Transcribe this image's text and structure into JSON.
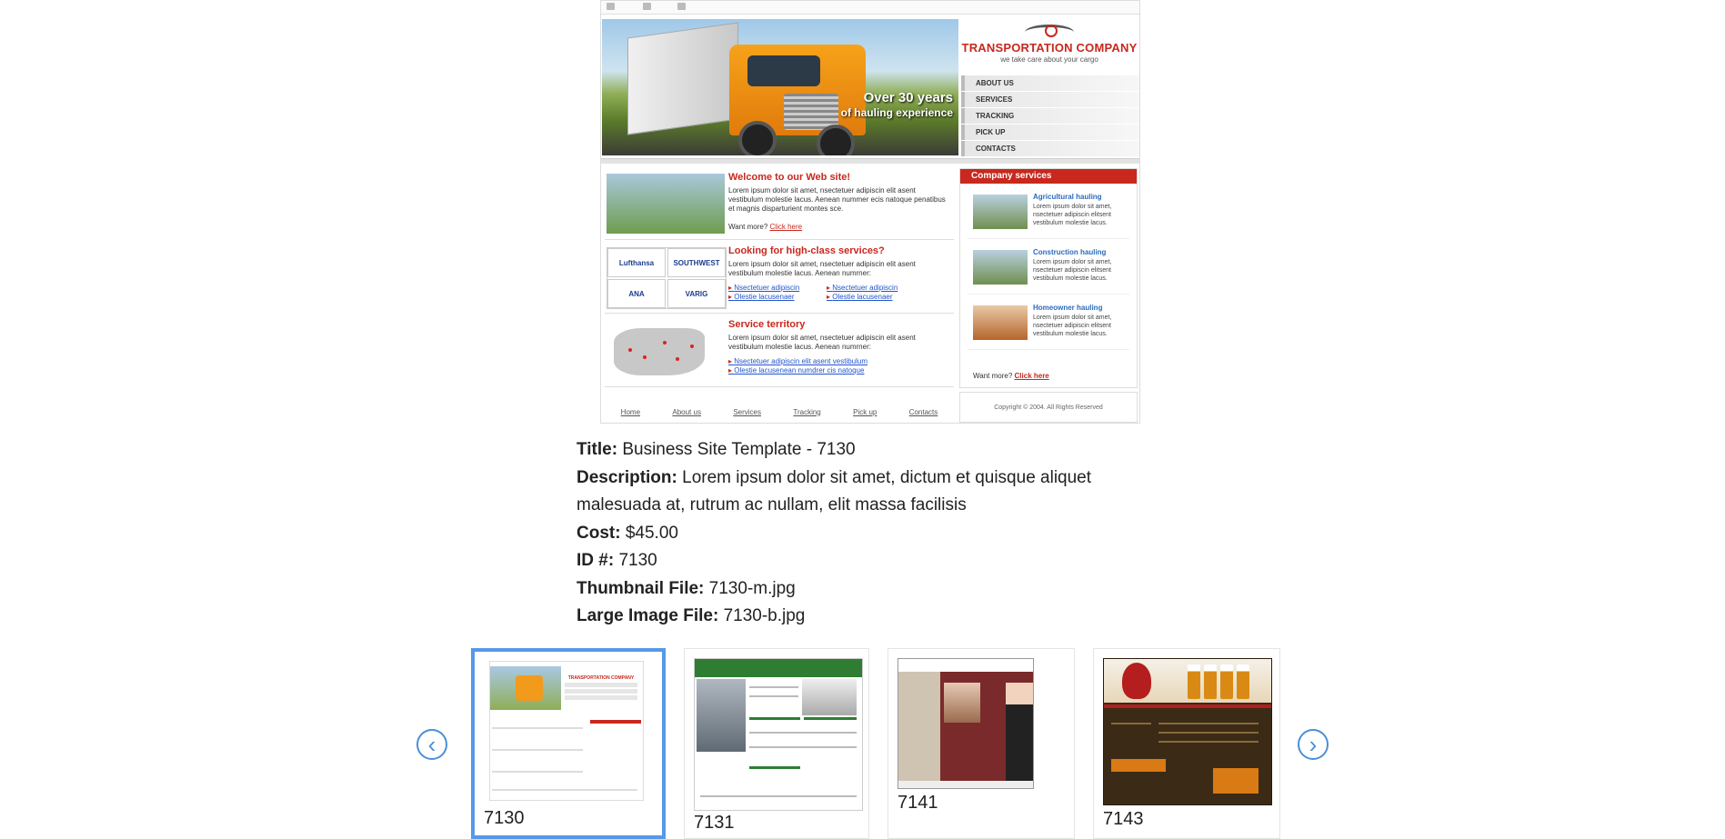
{
  "preview": {
    "hero_line1": "Over 30 years",
    "hero_line2": "of hauling experience",
    "logo": "TRANSPORTATION COMPANY",
    "tagline": "we take care about your cargo",
    "menu": [
      "ABOUT US",
      "SERVICES",
      "TRACKING",
      "PICK UP",
      "CONTACTS"
    ],
    "welcome_title": "Welcome to our Web site!",
    "welcome_text": "Lorem ipsum dolor sit amet, nsectetuer adipiscin elit asent vestibulum molestie lacus. Aenean nummer ecis natoque penatibus et magnis disparturient montes sce.",
    "want_more": "Want more?",
    "click_here": "Click here",
    "services_title": "Looking for high-class services?",
    "services_text": "Lorem ipsum dolor sit amet, nsectetuer adipiscin elit asent vestibulum molestie lacus. Aenean numrner:",
    "services_links": [
      "Nsectetuer adipiscin",
      "Olestie lacusenaer",
      "Nsectetuer adipiscin",
      "Olestie lacusenaer"
    ],
    "logos": [
      "Lufthansa",
      "SOUTHWEST",
      "ANA",
      "VARIG"
    ],
    "territory_title": "Service territory",
    "territory_text": "Lorem ipsum dolor sit amet, nsectetuer adipiscin elit asent vestibulum molestie lacus. Aenean numrner:",
    "territory_links": [
      "Nsectetuer adipiscin elit asent vestibulum",
      "Olestie lacusenean numdrer cis natoque"
    ],
    "company_services": "Company services",
    "svc": [
      {
        "title": "Agricultural hauling",
        "text": "Lorem ipsum dolor sit amet, nsectetuer adipiscin elitsent vestibulum molestie lacus."
      },
      {
        "title": "Construction hauling",
        "text": "Lorem ipsum dolor sit amet, nsectetuer adipiscin elitsent vestibulum molestie lacus."
      },
      {
        "title": "Homeowner hauling",
        "text": "Lorem ipsum dolor sit amet, nsectetuer adipiscin elitsent vestibulum molestie lacus."
      }
    ],
    "footer_nav": [
      "Home",
      "About us",
      "Services",
      "Tracking",
      "Pick up",
      "Contacts"
    ],
    "copyright": "Copyright © 2004. All Rights Reserved"
  },
  "details": {
    "title_label": "Title:",
    "title": "Business Site Template - 7130",
    "description_label": "Description:",
    "description": "Lorem ipsum dolor sit amet, dictum et quisque aliquet malesuada at, rutrum ac nullam, elit massa facilisis",
    "cost_label": "Cost:",
    "cost": "$45.00",
    "id_label": "ID #:",
    "id": "7130",
    "thumb_label": "Thumbnail File:",
    "thumb": "7130-m.jpg",
    "large_label": "Large Image File:",
    "large": "7130-b.jpg"
  },
  "carousel": {
    "prev_icon": "chevron-left-icon",
    "next_icon": "chevron-right-icon",
    "prev_glyph": "‹",
    "next_glyph": "›",
    "items": [
      {
        "id": "7130",
        "selected": true
      },
      {
        "id": "7131",
        "selected": false
      },
      {
        "id": "7141",
        "selected": false
      },
      {
        "id": "7143",
        "selected": false
      }
    ]
  },
  "colors": {
    "accent": "#5599e8",
    "brand_red": "#c8281e"
  }
}
